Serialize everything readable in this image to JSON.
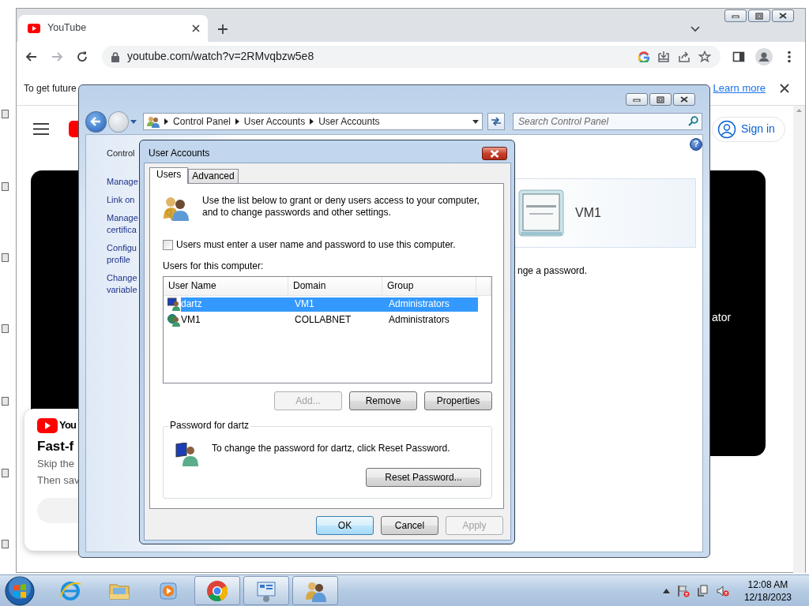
{
  "browser": {
    "tabs": [
      {
        "title": "YouTube",
        "selected": true
      }
    ],
    "url": "youtube.com/watch?v=2RMvqbzw5e8",
    "infobar": {
      "text": "To get future",
      "link": "Learn more"
    }
  },
  "youtube": {
    "sign_in": "Sign in",
    "video_caption": "ator",
    "promo": {
      "logo_text": "You",
      "title": "Fast-f",
      "lines": [
        "Skip the",
        "Then sav"
      ]
    }
  },
  "control_panel": {
    "breadcrumb": [
      "Control Panel",
      "User Accounts",
      "User Accounts"
    ],
    "search_placeholder": "Search Control Panel",
    "help": "?",
    "tasks": [
      "Control",
      "Manage",
      "Link on",
      "Manage\ncertifica",
      "Configu\nprofile",
      "Change\nvariable"
    ],
    "account": {
      "name": "VM1"
    },
    "note": "nge a password."
  },
  "dialog": {
    "title": "User Accounts",
    "tabs": [
      {
        "label": "Users",
        "selected": true
      },
      {
        "label": "Advanced",
        "selected": false
      }
    ],
    "intro": "Use the list below to grant or deny users access to your computer, and to change passwords and other settings.",
    "require_password": {
      "label": "Users must enter a user name and password to use this computer.",
      "checked": false
    },
    "list_label": "Users for this computer:",
    "columns": [
      "User Name",
      "Domain",
      "Group"
    ],
    "users": [
      {
        "kind": "local",
        "name": "dartz",
        "domain": "VM1",
        "group": "Administrators",
        "selected": true
      },
      {
        "kind": "domain",
        "name": "VM1",
        "domain": "COLLABNET",
        "group": "Administrators",
        "selected": false
      }
    ],
    "list_buttons": [
      {
        "label": "Add...",
        "disabled": true
      },
      {
        "label": "Remove",
        "disabled": false
      },
      {
        "label": "Properties",
        "disabled": false
      }
    ],
    "password": {
      "title": "Password for dartz",
      "text": "To change the password for dartz, click Reset Password.",
      "button": {
        "label": "Reset Password...",
        "disabled": false
      }
    },
    "buttons": [
      {
        "label": "OK",
        "default": true,
        "disabled": false
      },
      {
        "label": "Cancel",
        "default": false,
        "disabled": false
      },
      {
        "label": "Apply",
        "default": false,
        "disabled": true
      }
    ]
  },
  "taskbar": {
    "apps": [
      {
        "kind": "ie",
        "running": false
      },
      {
        "kind": "explorer",
        "running": false
      },
      {
        "kind": "media",
        "running": false
      },
      {
        "kind": "chrome",
        "running": true
      },
      {
        "kind": "control-panel",
        "running": true
      },
      {
        "kind": "user-accounts",
        "running": true
      }
    ],
    "clock": {
      "time": "12:08 AM",
      "date": "12/18/2023"
    }
  }
}
